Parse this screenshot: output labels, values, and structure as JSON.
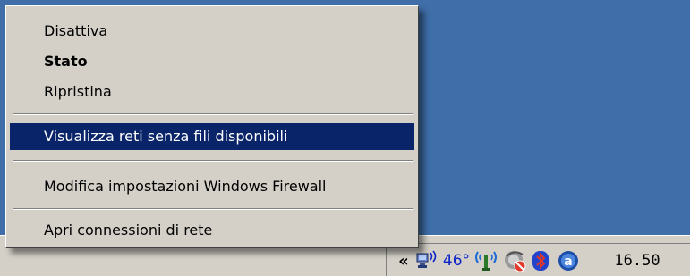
{
  "menu": {
    "items": [
      {
        "label": "Disattiva"
      },
      {
        "label": "Stato"
      },
      {
        "label": "Ripristina"
      },
      {
        "label": "Visualizza reti senza fili disponibili"
      },
      {
        "label": "Modifica impostazioni Windows Firewall"
      },
      {
        "label": "Apri connessioni di rete"
      }
    ]
  },
  "tray": {
    "chevron": "«",
    "temperature": "46°",
    "clock": "16.50",
    "icons": [
      "network-speaker-icon",
      "wireless-icon",
      "ie-blocked-icon",
      "bluetooth-icon",
      "ask-icon"
    ]
  },
  "colors": {
    "desktop": "#3f6ea8",
    "selection": "#0a246a",
    "menu_bg": "#d4d0c8",
    "temperature_text": "#0a24c8"
  }
}
